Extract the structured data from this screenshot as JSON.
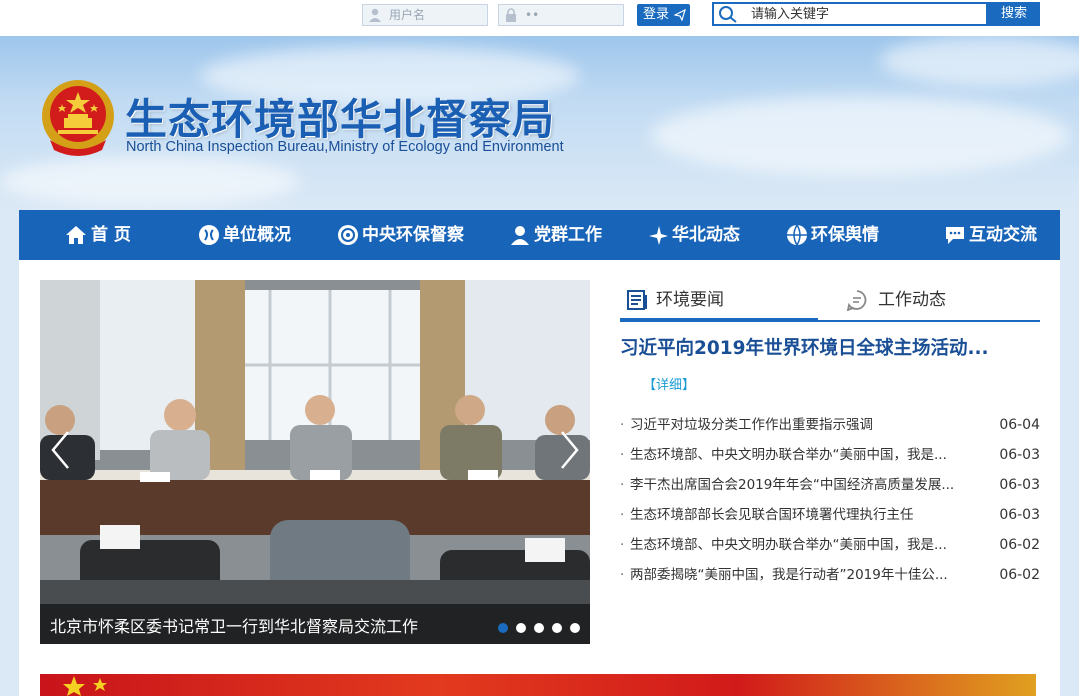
{
  "topbar": {
    "username_placeholder": "用户名",
    "password_placeholder": "••",
    "login_label": "登录",
    "search_placeholder": "请输入关键字",
    "search_label": "搜索"
  },
  "header": {
    "title": "生态环境部华北督察局",
    "subtitle": "North China Inspection Bureau,Ministry of Ecology and Environment"
  },
  "nav": {
    "items": [
      {
        "label": "首 页",
        "icon": "home-icon"
      },
      {
        "label": "单位概况",
        "icon": "building-icon"
      },
      {
        "label": "中央环保督察",
        "icon": "inspection-icon"
      },
      {
        "label": "党群工作",
        "icon": "party-icon"
      },
      {
        "label": "华北动态",
        "icon": "dynamic-icon"
      },
      {
        "label": "环保舆情",
        "icon": "globe-icon"
      },
      {
        "label": "互动交流",
        "icon": "chat-icon"
      }
    ]
  },
  "slider": {
    "caption": "北京市怀柔区委书记常卫一行到华北督察局交流工作",
    "dots": 5,
    "active_dot": 0
  },
  "news": {
    "tabs": [
      {
        "label": "环境要闻",
        "icon": "newspaper-icon"
      },
      {
        "label": "工作动态",
        "icon": "message-icon"
      }
    ],
    "headline": "习近平向2019年世界环境日全球主场活动...",
    "detail_label": "【详细】",
    "items": [
      {
        "title": "习近平对垃圾分类工作作出重要指示强调",
        "date": "06-04"
      },
      {
        "title": "生态环境部、中央文明办联合举办“美丽中国，我是...",
        "date": "06-03"
      },
      {
        "title": "李干杰出席国合会2019年年会“中国经济高质量发展...",
        "date": "06-03"
      },
      {
        "title": "生态环境部部长会见联合国环境署代理执行主任",
        "date": "06-03"
      },
      {
        "title": "生态环境部、中央文明办联合举办“美丽中国，我是...",
        "date": "06-02"
      },
      {
        "title": "两部委揭晓“美丽中国，我是行动者”2019年十佳公...",
        "date": "06-02"
      }
    ]
  },
  "colors": {
    "brand_blue": "#1864b8",
    "title_blue": "#1a5fb4",
    "link_cyan": "#1a9bd4"
  }
}
